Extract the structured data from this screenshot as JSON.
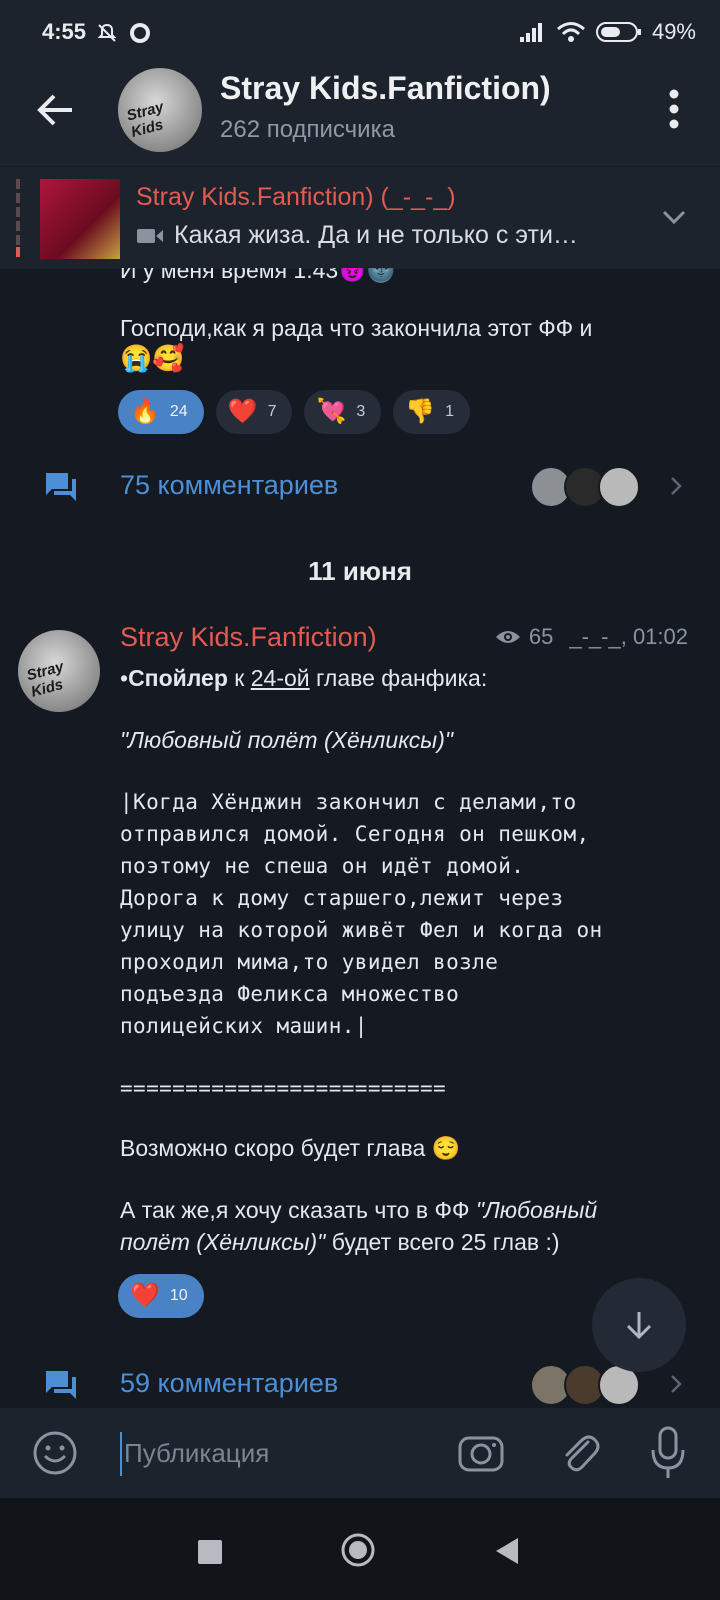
{
  "status": {
    "time": "4:55",
    "battery": "49%",
    "icons": [
      "mute-bell-icon",
      "app-notification-icon",
      "signal-icon",
      "wifi-icon",
      "battery-icon"
    ]
  },
  "header": {
    "title": "Stray Kids.Fanfiction)",
    "subtitle": "262 подписчика",
    "avatar_label": "Stray Kids"
  },
  "pinned": {
    "title": "Stray Kids.Fanfiction) (_-_-_)",
    "text": "Какая жиза. Да и не только с эти…"
  },
  "prev_post": {
    "line1": "И у меня время 1:43😈🌚",
    "line2": "Господи,как я рада что закончила этот ФФ и",
    "line3": "😭🥰",
    "reactions": [
      {
        "emoji": "🔥",
        "count": "24",
        "active": true
      },
      {
        "emoji": "❤️",
        "count": "7",
        "active": false
      },
      {
        "emoji": "💘",
        "count": "3",
        "active": false
      },
      {
        "emoji": "👎",
        "count": "1",
        "active": false
      }
    ],
    "comments": "75 комментариев"
  },
  "date_separator": "11 июня",
  "post": {
    "author": "Stray Kids.Fanfiction)",
    "views": "65",
    "signature_time": "_-_-_, 01:02",
    "spoiler_bullet": "•",
    "spoiler_bold": "Спойлер",
    "spoiler_k": " к ",
    "spoiler_chapter": "24-ой",
    "spoiler_rest": " главе фанфика:",
    "title_italic": "\"Любовный полёт (Хёнликсы)\"",
    "excerpt": [
      "|Когда Хёнджин закончил с делами,то",
      "отправился домой. Сегодня он пешком,",
      "поэтому не спеша он идёт домой.",
      "Дорога к дому старшего,лежит через",
      "улицу на которой живёт Фел и когда он",
      "проходил мима,то увидел возле",
      "подъезда Феликса множество",
      "полицейских машин.|"
    ],
    "divider": "=========================",
    "note": "Возможно скоро будет глава 😌",
    "final_prefix": "А так же,я хочу сказать что в ФФ ",
    "final_italic_1": "\"Любовный",
    "final_italic_2": "полёт (Хёнликсы)\"",
    "final_suffix": " будет всего 25 глав :)",
    "reaction_emoji": "❤️",
    "reaction_count": "10",
    "comments": "59 комментариев"
  },
  "input": {
    "placeholder": "Публикация"
  }
}
